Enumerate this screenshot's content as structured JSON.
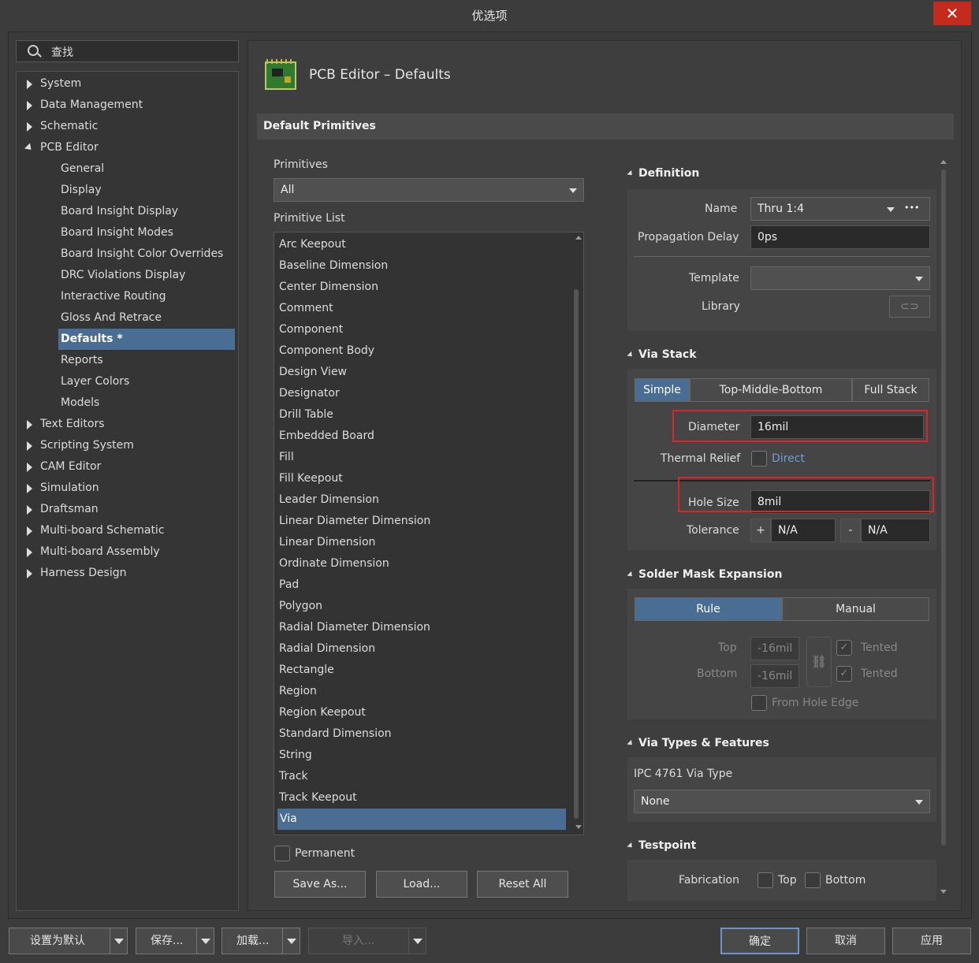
{
  "window": {
    "title": "优选项",
    "close": "✕"
  },
  "search": {
    "label": "查找"
  },
  "tree": {
    "top": [
      "System",
      "Data Management",
      "Schematic"
    ],
    "pcb": "PCB Editor",
    "pcb_children": [
      "General",
      "Display",
      "Board Insight Display",
      "Board Insight Modes",
      "Board Insight Color Overrides",
      "DRC Violations Display",
      "Interactive Routing",
      "Gloss And Retrace",
      "Defaults *",
      "Reports",
      "Layer Colors",
      "Models"
    ],
    "rest": [
      "Text Editors",
      "Scripting System",
      "CAM Editor",
      "Simulation",
      "Draftsman",
      "Multi-board Schematic",
      "Multi-board Assembly",
      "Harness Design"
    ]
  },
  "header": {
    "title": "PCB Editor – Defaults",
    "section": "Default Primitives"
  },
  "primitives": {
    "label": "Primitives",
    "value": "All",
    "list_label": "Primitive List",
    "items": [
      "Arc Keepout",
      "Baseline Dimension",
      "Center Dimension",
      "Comment",
      "Component",
      "Component Body",
      "Design View",
      "Designator",
      "Drill Table",
      "Embedded Board",
      "Fill",
      "Fill Keepout",
      "Leader Dimension",
      "Linear Diameter Dimension",
      "Linear Dimension",
      "Ordinate Dimension",
      "Pad",
      "Polygon",
      "Radial Diameter Dimension",
      "Radial Dimension",
      "Rectangle",
      "Region",
      "Region Keepout",
      "Standard Dimension",
      "String",
      "Track",
      "Track Keepout",
      "Via"
    ],
    "selected": "Via",
    "permanent": "Permanent",
    "save_as": "Save As...",
    "load": "Load...",
    "reset_all": "Reset All"
  },
  "definition": {
    "title": "Definition",
    "name_label": "Name",
    "name_value": "Thru 1:4",
    "more": "•••",
    "delay_label": "Propagation Delay",
    "delay_value": "0ps",
    "template_label": "Template",
    "library_label": "Library"
  },
  "via_stack": {
    "title": "Via Stack",
    "modes": [
      "Simple",
      "Top-Middle-Bottom",
      "Full Stack"
    ],
    "diameter_label": "Diameter",
    "diameter_value": "16mil",
    "thermal_label": "Thermal Relief",
    "thermal_value": "Direct",
    "hole_label": "Hole Size",
    "hole_value": "8mil",
    "tolerance_label": "Tolerance",
    "plus": "+",
    "minus": "-",
    "tol_plus": "N/A",
    "tol_minus": "N/A"
  },
  "solder_mask": {
    "title": "Solder Mask Expansion",
    "modes": [
      "Rule",
      "Manual"
    ],
    "top_label": "Top",
    "top_value": "-16mil",
    "bottom_label": "Bottom",
    "bottom_value": "-16mil",
    "tented": "Tented",
    "from_hole": "From Hole Edge"
  },
  "via_types": {
    "title": "Via Types & Features",
    "ipc_label": "IPC 4761 Via Type",
    "ipc_value": "None"
  },
  "testpoint": {
    "title": "Testpoint",
    "fab_label": "Fabrication",
    "top": "Top",
    "bottom": "Bottom"
  },
  "footer": {
    "set_default": "设置为默认",
    "save": "保存...",
    "load": "加载...",
    "import": "导入...",
    "ok": "确定",
    "cancel": "取消",
    "apply": "应用"
  }
}
